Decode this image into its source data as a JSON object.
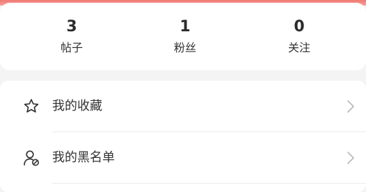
{
  "stats": [
    {
      "value": "3",
      "label": "帖子"
    },
    {
      "value": "1",
      "label": "粉丝"
    },
    {
      "value": "0",
      "label": "关注"
    }
  ],
  "menu": [
    {
      "label": "我的收藏",
      "icon": "star-icon"
    },
    {
      "label": "我的黑名单",
      "icon": "user-block-icon"
    }
  ],
  "colors": {
    "accent": "#f07a72",
    "text": "#333333",
    "chevron": "#b8b8b8"
  }
}
